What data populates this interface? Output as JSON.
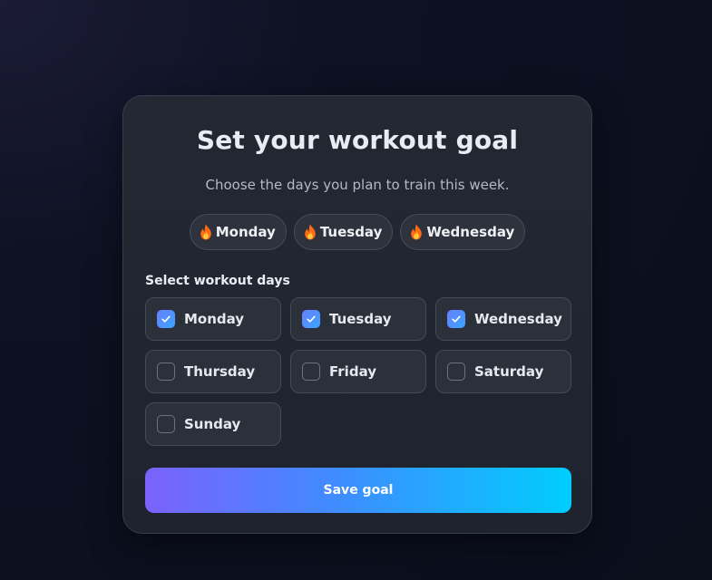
{
  "card": {
    "title": "Set your workout goal",
    "subtitle": "Choose the days you plan to train this week."
  },
  "selected_chips": [
    {
      "icon": "flame-icon",
      "label": "Monday"
    },
    {
      "icon": "flame-icon",
      "label": "Tuesday"
    },
    {
      "icon": "flame-icon",
      "label": "Wednesday"
    }
  ],
  "section_label": "Select workout days",
  "days": [
    {
      "label": "Monday",
      "checked": true
    },
    {
      "label": "Tuesday",
      "checked": true
    },
    {
      "label": "Wednesday",
      "checked": true
    },
    {
      "label": "Thursday",
      "checked": false
    },
    {
      "label": "Friday",
      "checked": false
    },
    {
      "label": "Saturday",
      "checked": false
    },
    {
      "label": "Sunday",
      "checked": false
    }
  ],
  "save_label": "Save goal",
  "colors": {
    "accent_start": "#7b62fb",
    "accent_end": "#00cdfd",
    "checkbox_checked": "#4f8dff",
    "flame": "#ff7a1a"
  }
}
